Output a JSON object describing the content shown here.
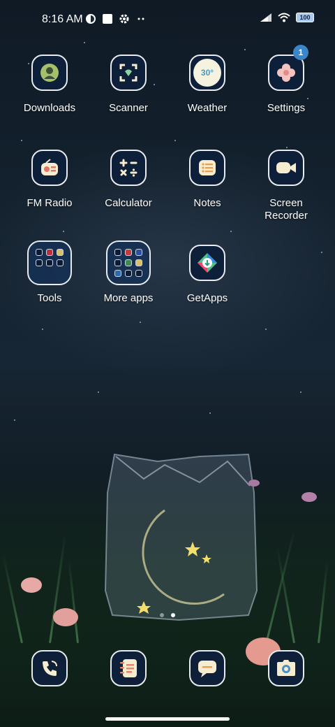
{
  "status_bar": {
    "time": "8:16 AM",
    "left_icons": [
      "data-saver-icon",
      "notification-square-icon",
      "gear-icon",
      "more-dots-icon"
    ],
    "right_icons": [
      "signal-icon",
      "wifi-icon",
      "battery-icon"
    ],
    "battery_level": "100"
  },
  "apps": [
    {
      "label": "Downloads",
      "icon": "downloads-icon"
    },
    {
      "label": "Scanner",
      "icon": "scanner-icon"
    },
    {
      "label": "Weather",
      "icon": "weather-icon",
      "icon_text": "30°"
    },
    {
      "label": "Settings",
      "icon": "settings-flower-icon",
      "badge": "1"
    },
    {
      "label": "FM Radio",
      "icon": "radio-icon"
    },
    {
      "label": "Calculator",
      "icon": "calculator-icon"
    },
    {
      "label": "Notes",
      "icon": "notes-icon"
    },
    {
      "label": "Screen Recorder",
      "icon": "video-camera-icon"
    },
    {
      "label": "Tools",
      "icon": "folder-icon"
    },
    {
      "label": "More apps",
      "icon": "folder-icon"
    },
    {
      "label": "GetApps",
      "icon": "getapps-icon"
    }
  ],
  "dock": [
    {
      "icon": "phone-icon"
    },
    {
      "icon": "contacts-notebook-icon"
    },
    {
      "icon": "messages-icon"
    },
    {
      "icon": "camera-icon"
    }
  ],
  "page_indicator": {
    "pages": 2,
    "active": 2
  },
  "colors": {
    "icon_bg": "#0e1f3a",
    "icon_border": "#e9ecef",
    "icon_accent": "#f6eccf",
    "badge": "#3a86c8"
  }
}
